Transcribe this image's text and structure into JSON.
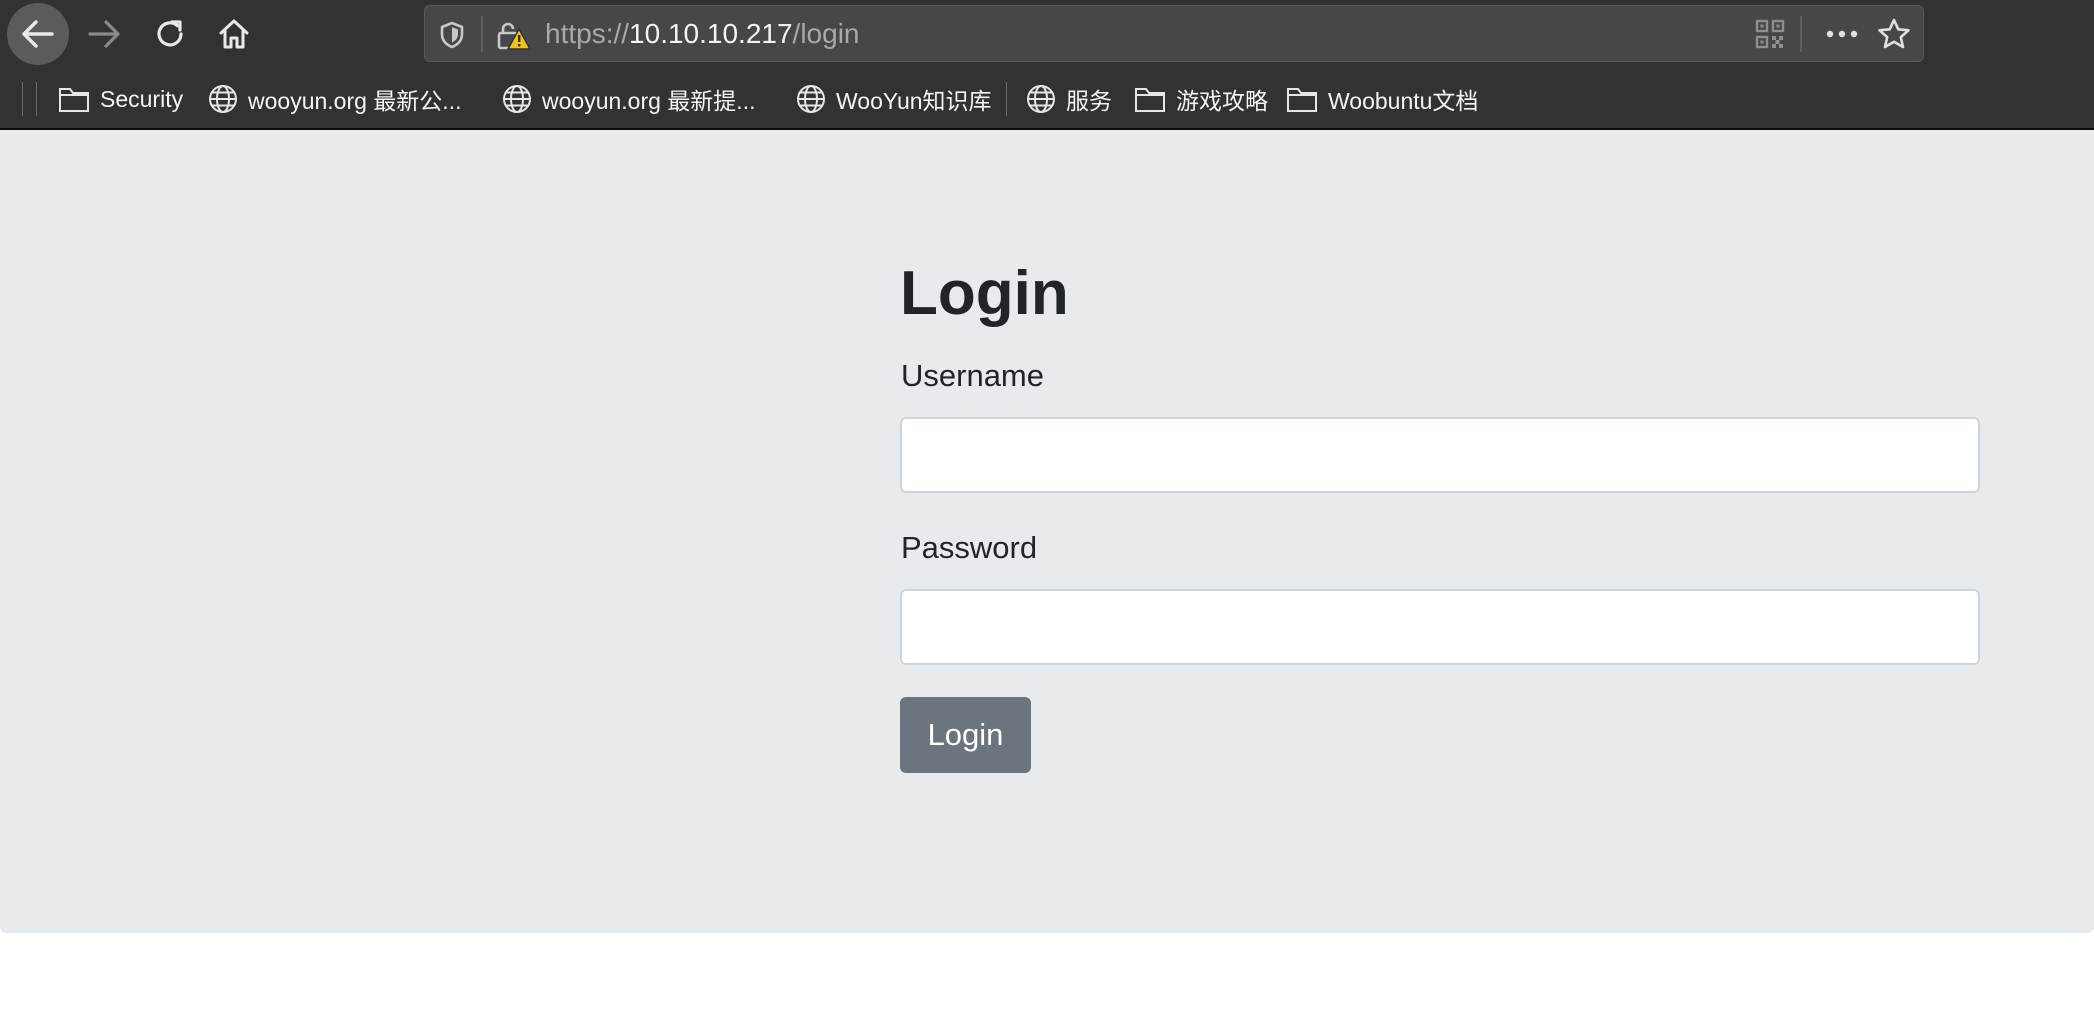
{
  "browser": {
    "url": {
      "scheme": "https://",
      "host": "10.10.10.217",
      "path": "/login"
    },
    "bookmarks": [
      {
        "label": "Security",
        "icon": "folder-icon"
      },
      {
        "label": "wooyun.org 最新公...",
        "icon": "globe-icon"
      },
      {
        "label": "wooyun.org 最新提...",
        "icon": "globe-icon"
      },
      {
        "label": "WooYun知识库",
        "icon": "globe-icon"
      },
      {
        "label": "服务",
        "icon": "globe-icon"
      },
      {
        "label": "游戏攻略",
        "icon": "folder-icon"
      },
      {
        "label": "Woobuntu文档",
        "icon": "folder-icon"
      }
    ]
  },
  "form": {
    "title": "Login",
    "username_label": "Username",
    "username_value": "",
    "password_label": "Password",
    "password_value": "",
    "submit_label": "Login"
  },
  "colors": {
    "toolbar": "#323234",
    "page_bg": "#e8ebee",
    "button": "#6c757d",
    "text": "#212529"
  }
}
